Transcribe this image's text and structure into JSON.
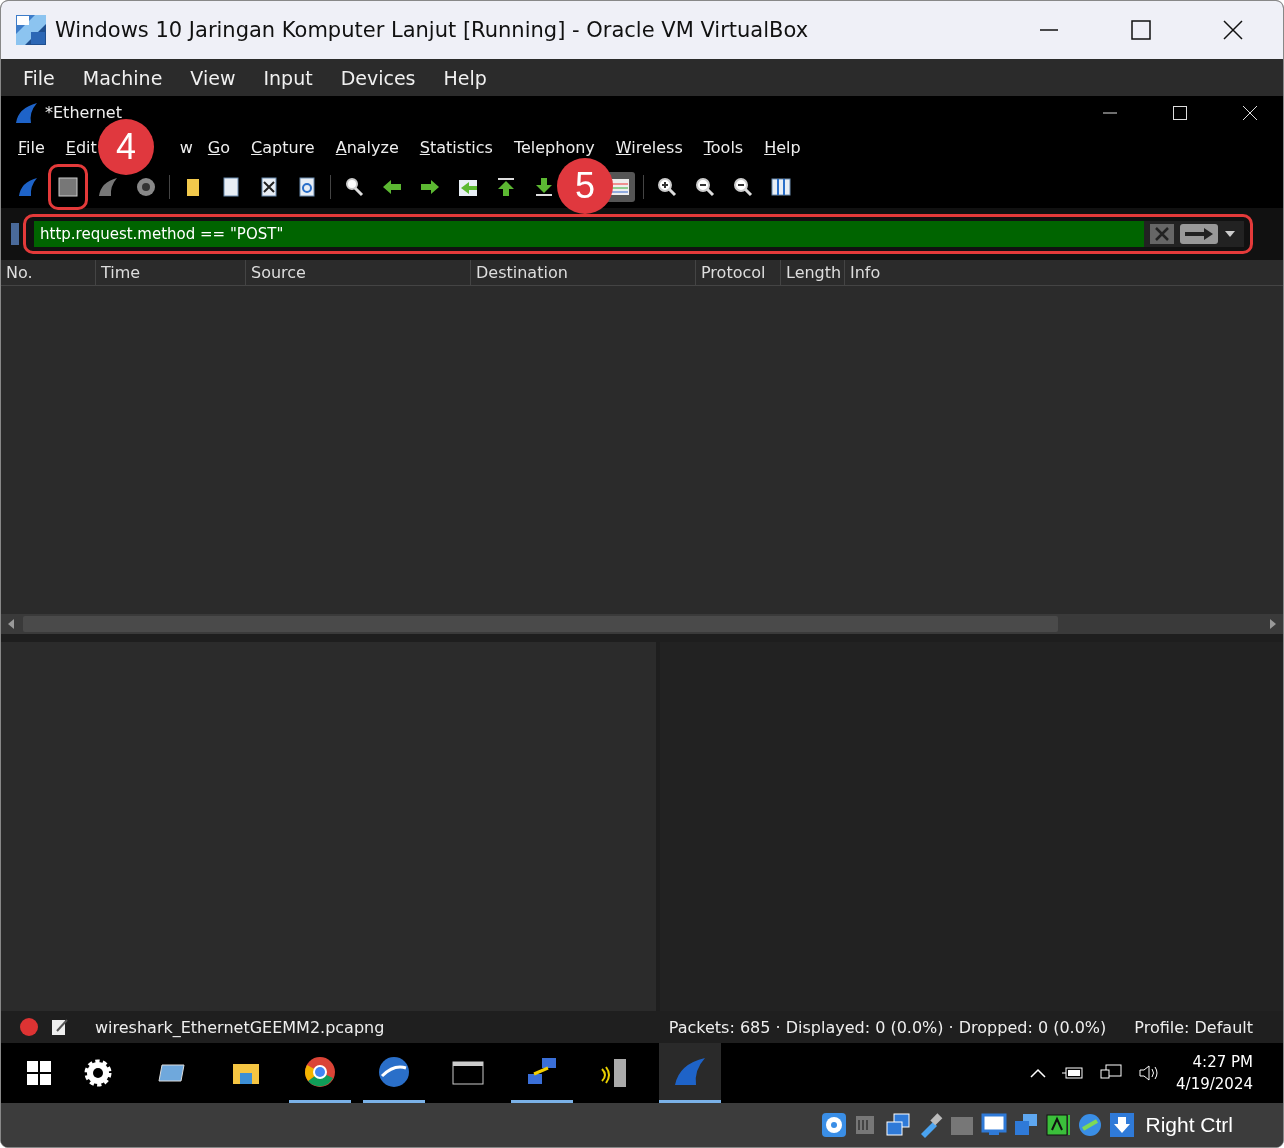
{
  "window": {
    "title": "Windows 10 Jaringan Komputer Lanjut [Running] - Oracle VM VirtualBox"
  },
  "vbox_menu": [
    "File",
    "Machine",
    "View",
    "Input",
    "Devices",
    "Help"
  ],
  "wireshark": {
    "title": "*Ethernet",
    "menu": [
      {
        "label": "File",
        "mnemonic": true
      },
      {
        "label": "Edit",
        "mnemonic": true
      },
      {
        "label": "w",
        "mnemonic": false
      },
      {
        "label": "Go",
        "mnemonic": true
      },
      {
        "label": "Capture",
        "mnemonic": true
      },
      {
        "label": "Analyze",
        "mnemonic": true
      },
      {
        "label": "Statistics",
        "mnemonic": true
      },
      {
        "label": "Telephony",
        "mnemonic": false
      },
      {
        "label": "Wireless",
        "mnemonic": true
      },
      {
        "label": "Tools",
        "mnemonic": true
      },
      {
        "label": "Help",
        "mnemonic": true
      }
    ],
    "filter": {
      "value": "http.request.method == \"POST\"",
      "valid": true
    },
    "columns": [
      "No.",
      "Time",
      "Source",
      "Destination",
      "Protocol",
      "Length",
      "Info"
    ],
    "status": {
      "file": "wireshark_EthernetGEEMM2.pcapng",
      "counts": "Packets: 685 · Displayed: 0 (0.0%) · Dropped: 0 (0.0%)",
      "profile": "Profile: Default"
    }
  },
  "annotations": [
    {
      "label": "4"
    },
    {
      "label": "5"
    }
  ],
  "taskbar": {
    "apps": [
      {
        "kind": "gear",
        "running": false,
        "selected": false
      },
      {
        "kind": "window",
        "running": false,
        "selected": false
      },
      {
        "kind": "folder",
        "running": false,
        "selected": false
      },
      {
        "kind": "browser",
        "running": true,
        "selected": false
      },
      {
        "kind": "globe",
        "running": true,
        "selected": false
      },
      {
        "kind": "terminal",
        "running": false,
        "selected": false
      },
      {
        "kind": "network",
        "running": true,
        "selected": false
      },
      {
        "kind": "server",
        "running": false,
        "selected": false
      },
      {
        "kind": "fin",
        "running": true,
        "selected": true
      }
    ],
    "time": "4:27 PM",
    "date": "4/19/2024"
  },
  "vbox_status": {
    "host_key": "Right Ctrl"
  }
}
